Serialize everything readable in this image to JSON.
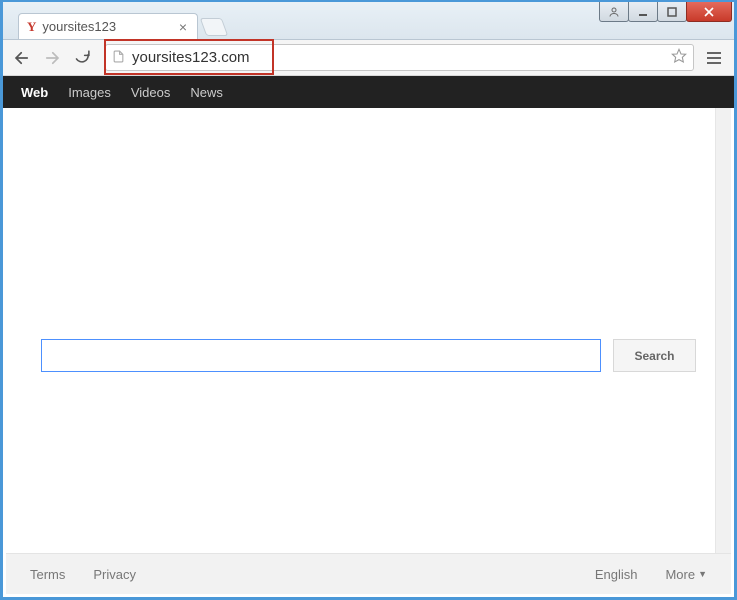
{
  "tab": {
    "title": "yoursites123"
  },
  "url": "yoursites123.com",
  "nav": {
    "items": [
      {
        "label": "Web",
        "active": true
      },
      {
        "label": "Images",
        "active": false
      },
      {
        "label": "Videos",
        "active": false
      },
      {
        "label": "News",
        "active": false
      }
    ]
  },
  "search": {
    "button": "Search",
    "value": ""
  },
  "footer": {
    "terms": "Terms",
    "privacy": "Privacy",
    "language": "English",
    "more": "More"
  }
}
